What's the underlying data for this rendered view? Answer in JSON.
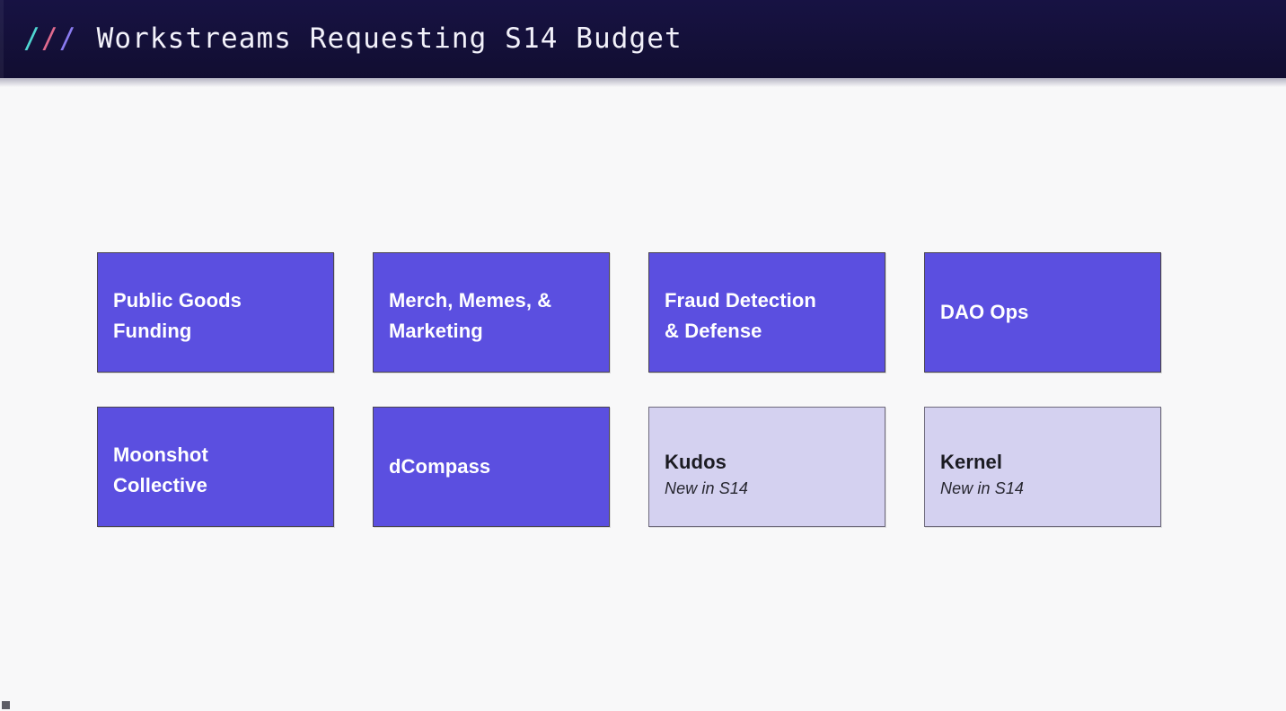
{
  "header": {
    "slashes": [
      "/",
      "/",
      "/"
    ],
    "slash_colors": [
      "#4fd6d2",
      "#e06a8e",
      "#8a7bf0"
    ],
    "title": "Workstreams Requesting S14 Budget",
    "background_color": "#141038"
  },
  "theme": {
    "page_background": "#f8f8f9",
    "card_filled_background": "#5b4fe0",
    "card_filled_text": "#ffffff",
    "card_tinted_background": "#d4d1f0",
    "card_tinted_text": "#1b1b22",
    "card_border": "#4a4552"
  },
  "grid": {
    "columns": 4,
    "rows": 2,
    "cards": [
      {
        "id": "public-goods-funding",
        "title": "Public Goods\nFunding",
        "subtitle": "",
        "style": "filled",
        "lines": 2
      },
      {
        "id": "merch-memes-marketing",
        "title": "Merch, Memes, &\nMarketing",
        "subtitle": "",
        "style": "filled",
        "lines": 2
      },
      {
        "id": "fraud-detection-defense",
        "title": "Fraud Detection\n& Defense",
        "subtitle": "",
        "style": "filled",
        "lines": 2
      },
      {
        "id": "dao-ops",
        "title": "DAO Ops",
        "subtitle": "",
        "style": "filled",
        "lines": 1
      },
      {
        "id": "moonshot-collective",
        "title": "Moonshot\nCollective",
        "subtitle": "",
        "style": "filled",
        "lines": 2
      },
      {
        "id": "dcompass",
        "title": "dCompass",
        "subtitle": "",
        "style": "filled",
        "lines": 1
      },
      {
        "id": "kudos",
        "title": "Kudos",
        "subtitle": "New in S14",
        "style": "tinted",
        "lines": 1
      },
      {
        "id": "kernel",
        "title": "Kernel",
        "subtitle": "New in S14",
        "style": "tinted",
        "lines": 1
      }
    ]
  }
}
